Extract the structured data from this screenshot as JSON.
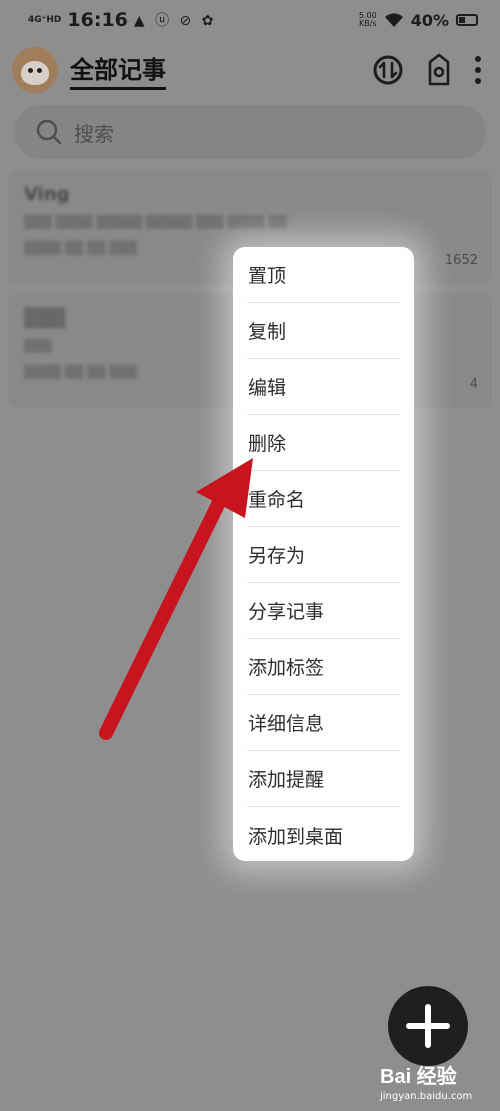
{
  "status_bar": {
    "network": "4G⁺HD",
    "time": "16:16",
    "app_icons": "▲ ⓤ ⊘ ✿",
    "speed_value": "5.00",
    "speed_unit": "KB/s",
    "battery_text": "40%",
    "battery_level": 0.4
  },
  "header": {
    "title": "全部记事"
  },
  "search": {
    "placeholder": "搜索"
  },
  "notes": [
    {
      "title": "Ving",
      "preview": "▒▒▒ ▒▒▒▒ ▒▒▒▒▒ ▒▒▒▒▒ ▒▒▒ ▒▒▒▒ ▒▒",
      "date": "▒▒▒▒ ▒▒ ▒▒ ▒▒▒",
      "count": "1652"
    },
    {
      "title": "▒▒▒",
      "preview": "▒▒▒",
      "date": "▒▒▒▒ ▒▒ ▒▒ ▒▒▒",
      "count": "4"
    }
  ],
  "context_menu": {
    "items": [
      "置顶",
      "复制",
      "编辑",
      "删除",
      "重命名",
      "另存为",
      "分享记事",
      "添加标签",
      "详细信息",
      "添加提醒",
      "添加到桌面"
    ]
  },
  "watermark": {
    "brand": "Bai 经验",
    "url": "jingyan.baidu.com"
  },
  "colors": {
    "arrow": "#c8141e",
    "menu_bg": "#ffffff",
    "dim_overlay": "#8e8e8e"
  }
}
